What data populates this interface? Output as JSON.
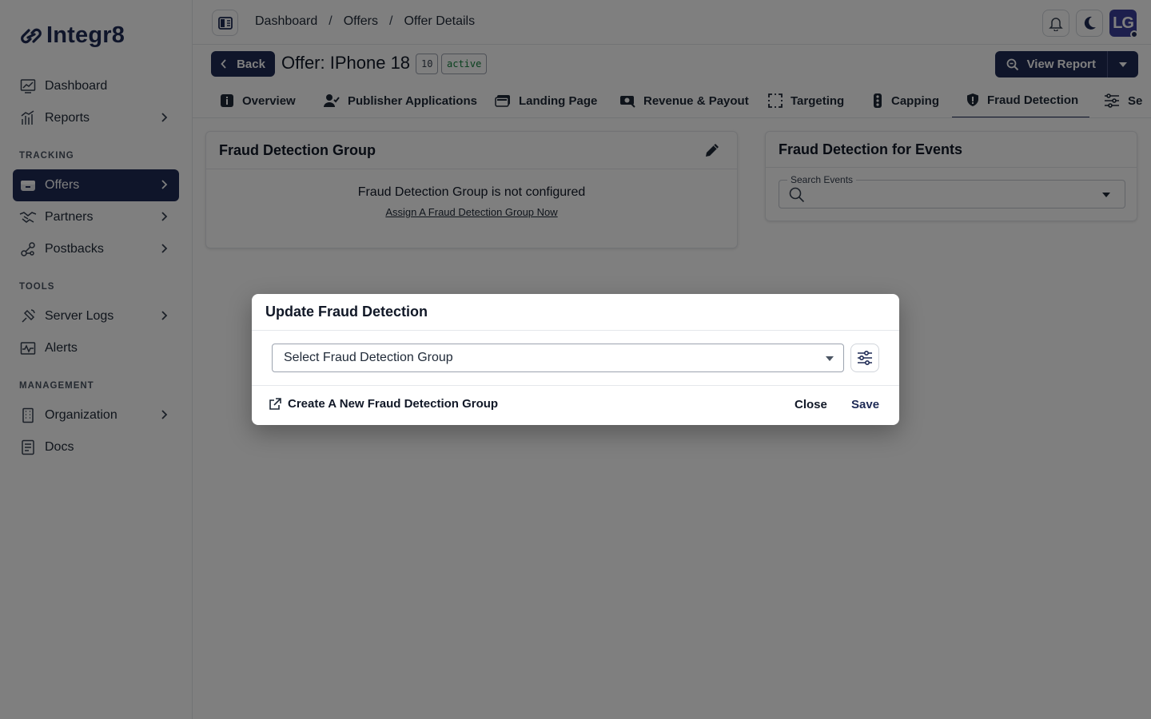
{
  "app": {
    "name": "Integr8"
  },
  "sidebar": {
    "items": [
      {
        "label": "Dashboard",
        "icon": "dashboard-chart-icon"
      },
      {
        "label": "Reports",
        "icon": "bar-chart-icon"
      },
      {
        "label": "Offers",
        "icon": "offers-store-icon"
      },
      {
        "label": "Partners",
        "icon": "handshake-icon"
      },
      {
        "label": "Postbacks",
        "icon": "link-nodes-icon"
      },
      {
        "label": "Server Logs",
        "icon": "satellite-icon"
      },
      {
        "label": "Alerts",
        "icon": "pulse-icon"
      },
      {
        "label": "Organization",
        "icon": "building-icon"
      },
      {
        "label": "Docs",
        "icon": "document-icon"
      }
    ],
    "sections": {
      "tracking": "TRACKING",
      "tools": "TOOLS",
      "management": "MANAGEMENT"
    }
  },
  "breadcrumb": {
    "items": [
      "Dashboard",
      "Offers",
      "Offer Details"
    ],
    "separator": "/"
  },
  "header": {
    "back_label": "Back",
    "offer_title": "Offer: IPhone 18",
    "offer_id": "10",
    "status": "active",
    "view_report_label": "View Report",
    "avatar_initials": "LG"
  },
  "tabs": [
    {
      "label": "Overview"
    },
    {
      "label": "Publisher Applications"
    },
    {
      "label": "Landing Page"
    },
    {
      "label": "Revenue & Payout"
    },
    {
      "label": "Targeting"
    },
    {
      "label": "Capping"
    },
    {
      "label": "Fraud Detection"
    },
    {
      "label": "Se"
    }
  ],
  "fraud_group_card": {
    "title": "Fraud Detection Group",
    "message": "Fraud Detection Group is not configured",
    "link": "Assign A Fraud Detection Group Now"
  },
  "events_card": {
    "title": "Fraud Detection for Events",
    "search_label": "Search Events"
  },
  "modal": {
    "title": "Update Fraud Detection",
    "select_placeholder": "Select Fraud Detection Group",
    "create_link": "Create A New Fraud Detection Group",
    "close_label": "Close",
    "save_label": "Save"
  },
  "colors": {
    "primary": "#1e2a55",
    "active_status": "#15803d",
    "overlay": "rgba(0,0,0,0.5)"
  }
}
